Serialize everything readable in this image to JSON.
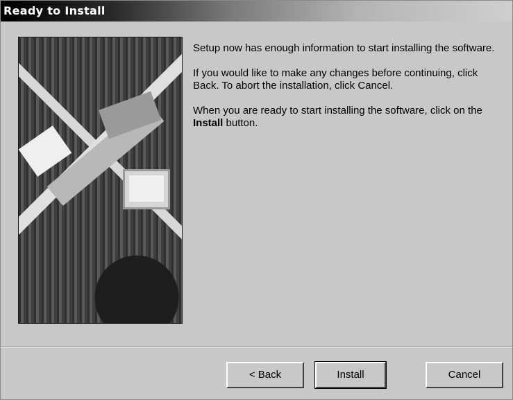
{
  "window": {
    "title": "Ready to Install"
  },
  "message": {
    "line1": "Setup now has enough information to start installing the software.",
    "line2": "If you would like to make any changes before continuing, click Back.  To abort the installation, click Cancel.",
    "line3_prefix": "When you are ready to start installing the software, click on the ",
    "line3_bold": "Install",
    "line3_suffix": " button."
  },
  "buttons": {
    "back_label": "< Back",
    "install_label": "Install",
    "cancel_label": "Cancel"
  },
  "banner": {
    "icon": "computer-hardware-illustration"
  },
  "colors": {
    "dialog_background": "#c8c8c8",
    "title_text": "#ffffff"
  }
}
